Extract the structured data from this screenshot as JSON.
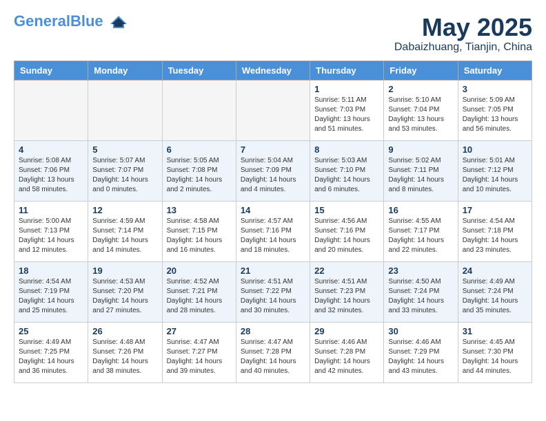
{
  "header": {
    "logo_general": "General",
    "logo_blue": "Blue",
    "month": "May 2025",
    "location": "Dabaizhuang, Tianjin, China"
  },
  "days_of_week": [
    "Sunday",
    "Monday",
    "Tuesday",
    "Wednesday",
    "Thursday",
    "Friday",
    "Saturday"
  ],
  "weeks": [
    [
      {
        "day": null
      },
      {
        "day": null
      },
      {
        "day": null
      },
      {
        "day": null
      },
      {
        "day": 1,
        "info": "Sunrise: 5:11 AM\nSunset: 7:03 PM\nDaylight: 13 hours\nand 51 minutes."
      },
      {
        "day": 2,
        "info": "Sunrise: 5:10 AM\nSunset: 7:04 PM\nDaylight: 13 hours\nand 53 minutes."
      },
      {
        "day": 3,
        "info": "Sunrise: 5:09 AM\nSunset: 7:05 PM\nDaylight: 13 hours\nand 56 minutes."
      }
    ],
    [
      {
        "day": 4,
        "info": "Sunrise: 5:08 AM\nSunset: 7:06 PM\nDaylight: 13 hours\nand 58 minutes."
      },
      {
        "day": 5,
        "info": "Sunrise: 5:07 AM\nSunset: 7:07 PM\nDaylight: 14 hours\nand 0 minutes."
      },
      {
        "day": 6,
        "info": "Sunrise: 5:05 AM\nSunset: 7:08 PM\nDaylight: 14 hours\nand 2 minutes."
      },
      {
        "day": 7,
        "info": "Sunrise: 5:04 AM\nSunset: 7:09 PM\nDaylight: 14 hours\nand 4 minutes."
      },
      {
        "day": 8,
        "info": "Sunrise: 5:03 AM\nSunset: 7:10 PM\nDaylight: 14 hours\nand 6 minutes."
      },
      {
        "day": 9,
        "info": "Sunrise: 5:02 AM\nSunset: 7:11 PM\nDaylight: 14 hours\nand 8 minutes."
      },
      {
        "day": 10,
        "info": "Sunrise: 5:01 AM\nSunset: 7:12 PM\nDaylight: 14 hours\nand 10 minutes."
      }
    ],
    [
      {
        "day": 11,
        "info": "Sunrise: 5:00 AM\nSunset: 7:13 PM\nDaylight: 14 hours\nand 12 minutes."
      },
      {
        "day": 12,
        "info": "Sunrise: 4:59 AM\nSunset: 7:14 PM\nDaylight: 14 hours\nand 14 minutes."
      },
      {
        "day": 13,
        "info": "Sunrise: 4:58 AM\nSunset: 7:15 PM\nDaylight: 14 hours\nand 16 minutes."
      },
      {
        "day": 14,
        "info": "Sunrise: 4:57 AM\nSunset: 7:16 PM\nDaylight: 14 hours\nand 18 minutes."
      },
      {
        "day": 15,
        "info": "Sunrise: 4:56 AM\nSunset: 7:16 PM\nDaylight: 14 hours\nand 20 minutes."
      },
      {
        "day": 16,
        "info": "Sunrise: 4:55 AM\nSunset: 7:17 PM\nDaylight: 14 hours\nand 22 minutes."
      },
      {
        "day": 17,
        "info": "Sunrise: 4:54 AM\nSunset: 7:18 PM\nDaylight: 14 hours\nand 23 minutes."
      }
    ],
    [
      {
        "day": 18,
        "info": "Sunrise: 4:54 AM\nSunset: 7:19 PM\nDaylight: 14 hours\nand 25 minutes."
      },
      {
        "day": 19,
        "info": "Sunrise: 4:53 AM\nSunset: 7:20 PM\nDaylight: 14 hours\nand 27 minutes."
      },
      {
        "day": 20,
        "info": "Sunrise: 4:52 AM\nSunset: 7:21 PM\nDaylight: 14 hours\nand 28 minutes."
      },
      {
        "day": 21,
        "info": "Sunrise: 4:51 AM\nSunset: 7:22 PM\nDaylight: 14 hours\nand 30 minutes."
      },
      {
        "day": 22,
        "info": "Sunrise: 4:51 AM\nSunset: 7:23 PM\nDaylight: 14 hours\nand 32 minutes."
      },
      {
        "day": 23,
        "info": "Sunrise: 4:50 AM\nSunset: 7:24 PM\nDaylight: 14 hours\nand 33 minutes."
      },
      {
        "day": 24,
        "info": "Sunrise: 4:49 AM\nSunset: 7:24 PM\nDaylight: 14 hours\nand 35 minutes."
      }
    ],
    [
      {
        "day": 25,
        "info": "Sunrise: 4:49 AM\nSunset: 7:25 PM\nDaylight: 14 hours\nand 36 minutes."
      },
      {
        "day": 26,
        "info": "Sunrise: 4:48 AM\nSunset: 7:26 PM\nDaylight: 14 hours\nand 38 minutes."
      },
      {
        "day": 27,
        "info": "Sunrise: 4:47 AM\nSunset: 7:27 PM\nDaylight: 14 hours\nand 39 minutes."
      },
      {
        "day": 28,
        "info": "Sunrise: 4:47 AM\nSunset: 7:28 PM\nDaylight: 14 hours\nand 40 minutes."
      },
      {
        "day": 29,
        "info": "Sunrise: 4:46 AM\nSunset: 7:28 PM\nDaylight: 14 hours\nand 42 minutes."
      },
      {
        "day": 30,
        "info": "Sunrise: 4:46 AM\nSunset: 7:29 PM\nDaylight: 14 hours\nand 43 minutes."
      },
      {
        "day": 31,
        "info": "Sunrise: 4:45 AM\nSunset: 7:30 PM\nDaylight: 14 hours\nand 44 minutes."
      }
    ]
  ]
}
